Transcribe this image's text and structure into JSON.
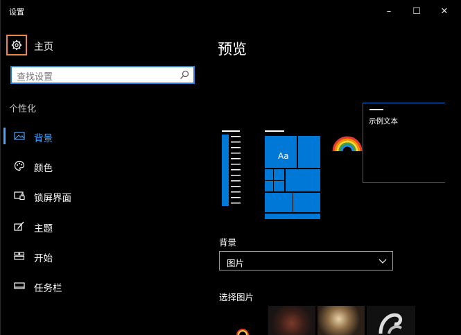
{
  "window": {
    "title": "设置",
    "minimize": "–",
    "maximize": "☐",
    "close": "✕"
  },
  "sidebar": {
    "home_label": "主页",
    "search_placeholder": "查找设置",
    "section_title": "个性化",
    "items": [
      {
        "label": "背景",
        "icon": "picture-icon",
        "active": true
      },
      {
        "label": "颜色",
        "icon": "palette-icon",
        "active": false
      },
      {
        "label": "锁屏界面",
        "icon": "lock-screen-icon",
        "active": false
      },
      {
        "label": "主题",
        "icon": "theme-brush-icon",
        "active": false
      },
      {
        "label": "开始",
        "icon": "start-tiles-icon",
        "active": false
      },
      {
        "label": "任务栏",
        "icon": "taskbar-icon",
        "active": false
      }
    ]
  },
  "main": {
    "heading": "预览",
    "preview": {
      "tile_text": "Aa",
      "sample_text": "示例文本"
    },
    "background_label": "背景",
    "background_value": "图片",
    "choose_picture_label": "选择图片"
  },
  "colors": {
    "accent": "#0078d7",
    "highlight": "#4aa3ff",
    "focus": "#e8894a",
    "background": "#000000"
  }
}
